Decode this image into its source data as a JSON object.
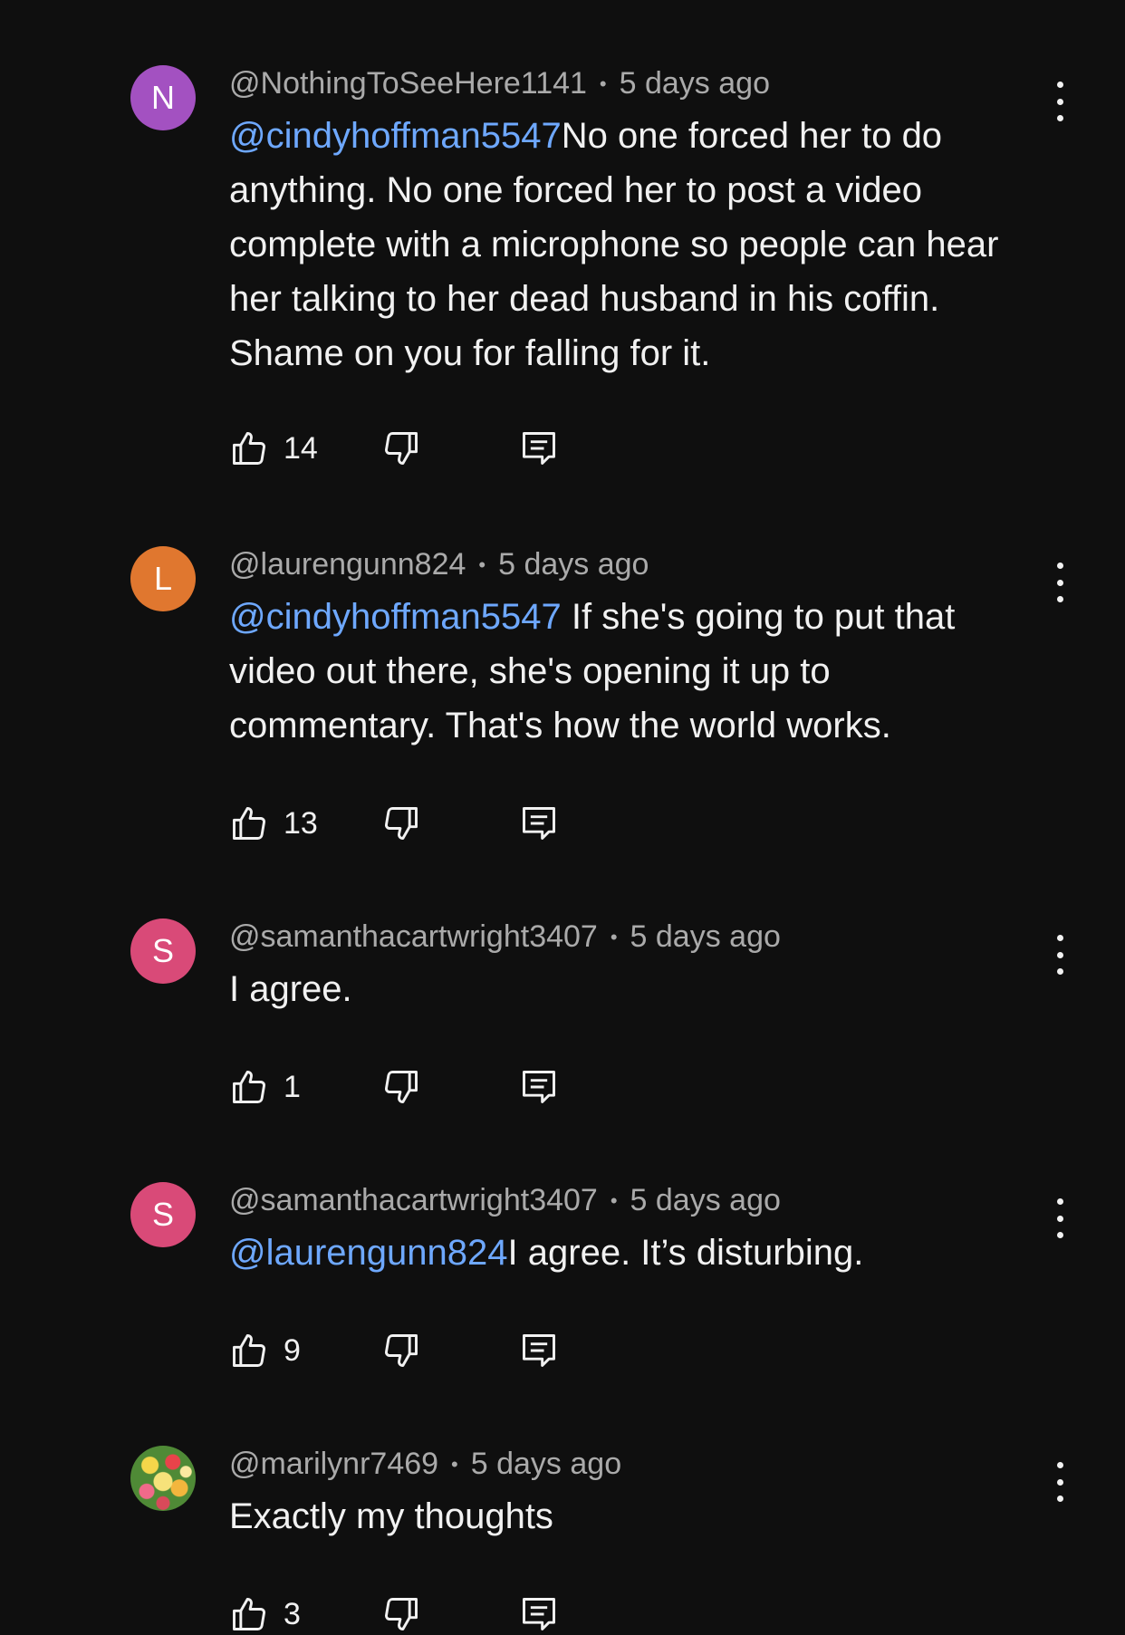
{
  "comments": [
    {
      "avatar_letter": "N",
      "avatar_color": "#a351c1",
      "author": "@NothingToSeeHere1141",
      "time": "5 days ago",
      "mention": "@cindyhoffman5547",
      "body": "No one forced her to do anything.  No one forced her to post a video complete with a microphone so people can hear her talking to her dead husband in his coffin.  Shame on you for falling for it.",
      "likes": "14"
    },
    {
      "avatar_letter": "L",
      "avatar_color": "#e0772f",
      "author": "@laurengunn824",
      "time": "5 days ago",
      "mention": "@cindyhoffman5547",
      "body": " If she's going to put that video out there, she's opening it up to commentary. That's how the world works.",
      "likes": "13"
    },
    {
      "avatar_letter": "S",
      "avatar_color": "#d94a78",
      "author": "@samanthacartwright3407",
      "time": "5 days ago",
      "mention": "",
      "body": "I agree.",
      "likes": "1"
    },
    {
      "avatar_letter": "S",
      "avatar_color": "#d94a78",
      "author": "@samanthacartwright3407",
      "time": "5 days ago",
      "mention": "@laurengunn824",
      "body": "I agree. It’s disturbing.",
      "likes": "9"
    },
    {
      "avatar_letter": "",
      "avatar_color": "",
      "author": "@marilynr7469",
      "time": "5 days ago",
      "mention": "",
      "body": "Exactly my thoughts",
      "likes": "3"
    }
  ],
  "separator": "•",
  "icons": {
    "like": "thumbs-up-icon",
    "dislike": "thumbs-down-icon",
    "reply": "reply-icon",
    "more": "more-vert-icon"
  }
}
